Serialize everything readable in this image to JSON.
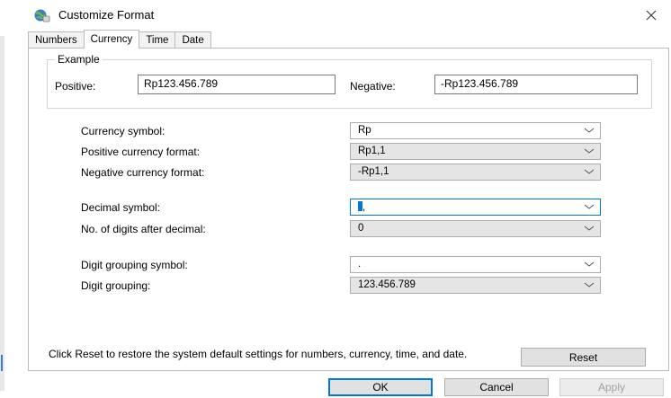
{
  "window": {
    "title": "Customize Format"
  },
  "tabs": [
    {
      "label": "Numbers",
      "active": false
    },
    {
      "label": "Currency",
      "active": true
    },
    {
      "label": "Time",
      "active": false
    },
    {
      "label": "Date",
      "active": false
    }
  ],
  "example": {
    "legend": "Example",
    "positive_label": "Positive:",
    "positive_value": "Rp123.456.789",
    "negative_label": "Negative:",
    "negative_value": "-Rp123.456.789"
  },
  "fields": {
    "currency_symbol": {
      "label": "Currency symbol:",
      "value": "Rp"
    },
    "positive_format": {
      "label": "Positive currency format:",
      "value": "Rp1,1"
    },
    "negative_format": {
      "label": "Negative currency format:",
      "value": "-Rp1,1"
    },
    "decimal_symbol": {
      "label": "Decimal symbol:",
      "value": ","
    },
    "digits_after_decimal": {
      "label": "No. of digits after decimal:",
      "value": "0"
    },
    "digit_grouping_symbol": {
      "label": "Digit grouping symbol:",
      "value": "."
    },
    "digit_grouping": {
      "label": "Digit grouping:",
      "value": "123.456.789"
    }
  },
  "reset": {
    "text": "Click Reset to restore the system default settings for numbers, currency, time, and date.",
    "button": "Reset"
  },
  "footer": {
    "ok": "OK",
    "cancel": "Cancel",
    "apply": "Apply"
  },
  "colors": {
    "accent": "#0078d7",
    "combo_gray": "#e5e5e5",
    "border": "#adadad"
  },
  "icons": {
    "title": "globe-settings-icon",
    "close": "close-icon",
    "dropdown": "chevron-down-icon"
  }
}
